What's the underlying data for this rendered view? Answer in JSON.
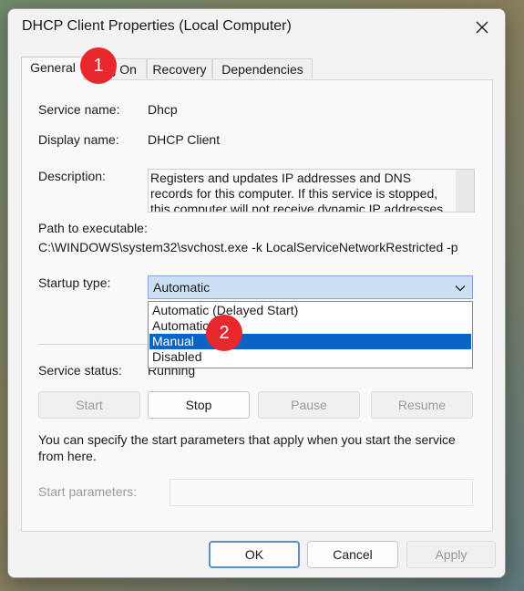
{
  "window": {
    "title": "DHCP Client Properties (Local Computer)"
  },
  "tabs": [
    {
      "label": "General",
      "active": true
    },
    {
      "label": "Log On",
      "active": false
    },
    {
      "label": "Recovery",
      "active": false
    },
    {
      "label": "Dependencies",
      "active": false
    }
  ],
  "general": {
    "service_name_label": "Service name:",
    "service_name": "Dhcp",
    "display_name_label": "Display name:",
    "display_name": "DHCP Client",
    "description_label": "Description:",
    "description": "Registers and updates IP addresses and DNS records for this computer. If this service is stopped, this computer will not receive dynamic IP addresses",
    "path_label": "Path to executable:",
    "path": "C:\\WINDOWS\\system32\\svchost.exe -k LocalServiceNetworkRestricted -p",
    "startup_label": "Startup type:",
    "startup_value": "Automatic",
    "startup_options": [
      {
        "label": "Automatic (Delayed Start)",
        "selected": false
      },
      {
        "label": "Automatic",
        "selected": false
      },
      {
        "label": "Manual",
        "selected": true
      },
      {
        "label": "Disabled",
        "selected": false
      }
    ],
    "status_label": "Service status:",
    "status_value": "Running",
    "buttons": {
      "start": {
        "label": "Start",
        "enabled": false
      },
      "stop": {
        "label": "Stop",
        "enabled": true
      },
      "pause": {
        "label": "Pause",
        "enabled": false
      },
      "resume": {
        "label": "Resume",
        "enabled": false
      }
    },
    "note": "You can specify the start parameters that apply when you start the service from here.",
    "start_params_label": "Start parameters:",
    "start_params_value": ""
  },
  "footer": {
    "ok": "OK",
    "cancel": "Cancel",
    "apply": "Apply"
  },
  "badges": [
    {
      "label": "1"
    },
    {
      "label": "2"
    }
  ],
  "colors": {
    "badge": "#e8282c",
    "selection": "#0a64c8",
    "select_bg": "#cce0f5"
  },
  "icons": {
    "close": "close-icon",
    "dropdown": "chevron-down-icon"
  }
}
